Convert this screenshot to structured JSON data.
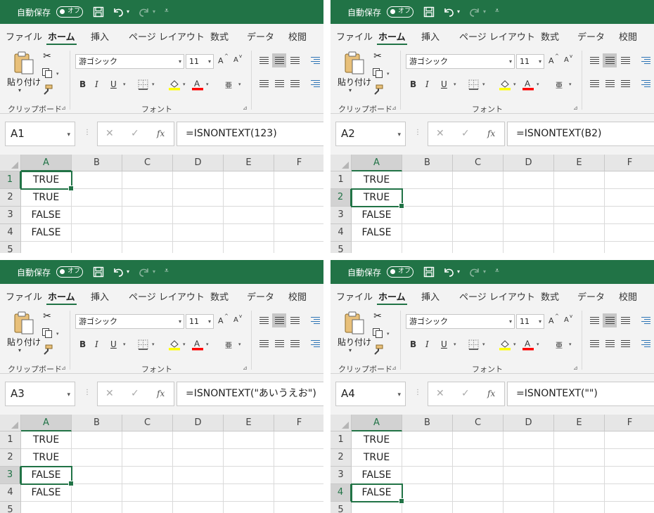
{
  "app": {
    "autosave_label": "自動保存",
    "autosave_state": "オフ",
    "tabs": [
      "ファイル",
      "ホーム",
      "挿入",
      "ページ レイアウト",
      "数式",
      "データ",
      "校閲"
    ],
    "active_tab_index": 1,
    "clipboard": {
      "paste_label": "貼り付け",
      "group_label": "クリップボード"
    },
    "font": {
      "name": "游ゴシック",
      "size": "11",
      "group_label": "フォント",
      "bold": "B",
      "italic": "I",
      "underline": "U",
      "grow": "A",
      "shrink": "A",
      "phonetic": "亜"
    },
    "fx_label": "fx"
  },
  "columns": [
    "A",
    "B",
    "C",
    "D",
    "E",
    "F"
  ],
  "rows": [
    "1",
    "2",
    "3",
    "4",
    "5"
  ],
  "column_a_values": [
    "TRUE",
    "TRUE",
    "FALSE",
    "FALSE",
    ""
  ],
  "panes": [
    {
      "name_box": "A1",
      "formula": "=ISNONTEXT(123)",
      "active_row": 1
    },
    {
      "name_box": "A2",
      "formula": "=ISNONTEXT(B2)",
      "active_row": 2
    },
    {
      "name_box": "A3",
      "formula": "=ISNONTEXT(\"あいうえお\")",
      "active_row": 3
    },
    {
      "name_box": "A4",
      "formula": "=ISNONTEXT(\"\")",
      "active_row": 4
    }
  ],
  "colors": {
    "title_bar": "#217346",
    "ribbon": "#f3f3f3",
    "selection": "#217346",
    "highlight_yellow": "#ffff00",
    "font_red": "#ff0000"
  },
  "icons": [
    "save-icon",
    "undo-icon",
    "redo-icon",
    "paste-icon",
    "cut-icon",
    "copy-icon",
    "format-painter-icon",
    "borders-icon",
    "fill-color-icon",
    "font-color-icon",
    "align-icon"
  ]
}
